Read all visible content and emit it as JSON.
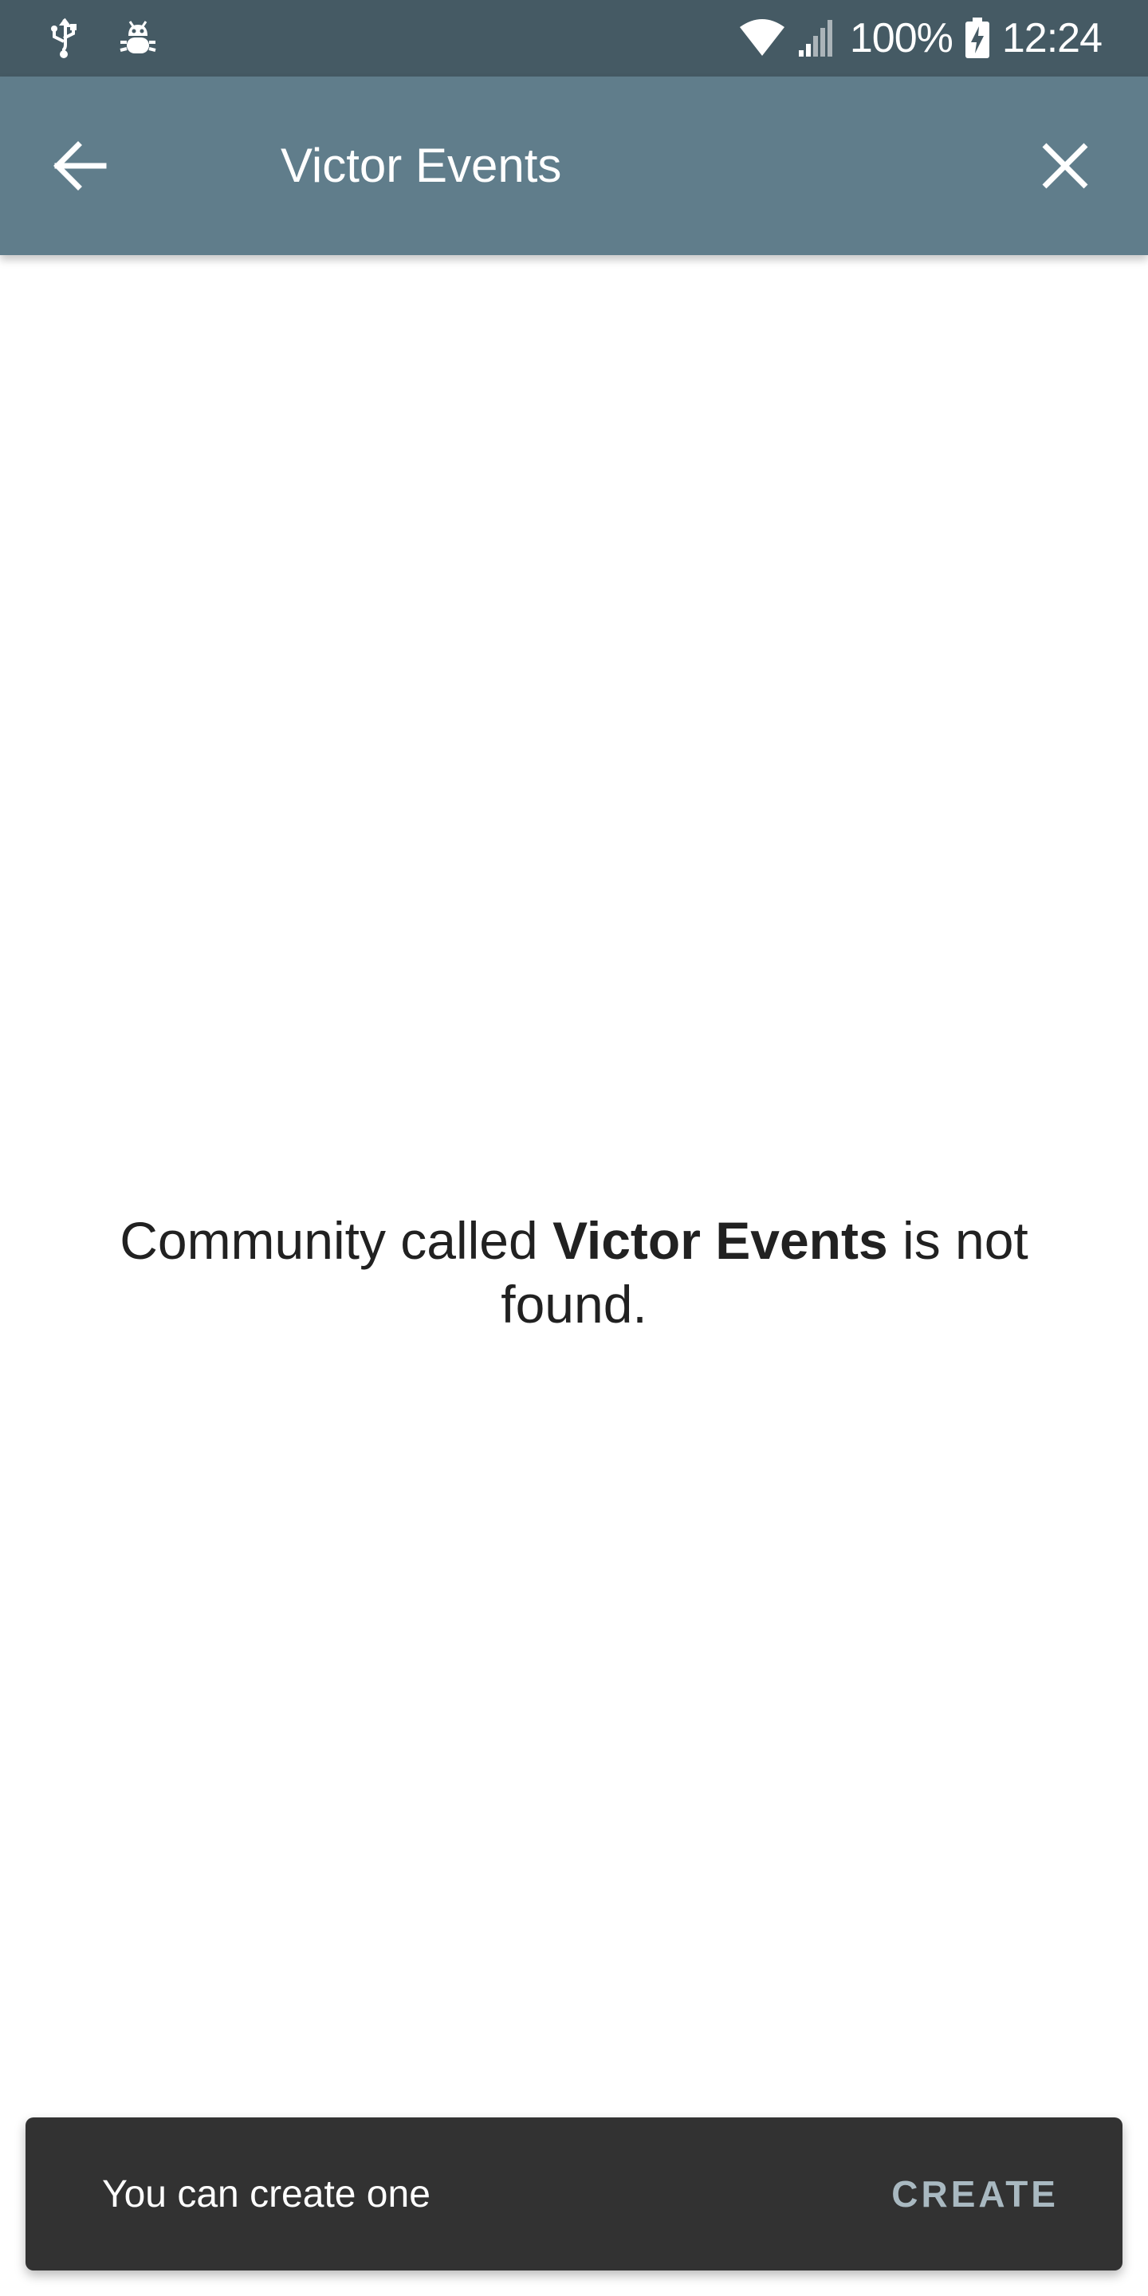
{
  "status_bar": {
    "left_icons": [
      "usb-icon",
      "debug-bug-icon"
    ],
    "right_icons": [
      "wifi-icon",
      "cell-signal-icon",
      "battery-charging-icon"
    ],
    "battery_text": "100%",
    "time": "12:24"
  },
  "app_bar": {
    "back_icon": "arrow-left-icon",
    "title": "Victor Events",
    "close_icon": "close-icon",
    "background_color": "#607d8b"
  },
  "main": {
    "message_prefix": "Community called ",
    "community_name": "Victor Events",
    "message_suffix_line1": " is not",
    "message_suffix_line2": "found."
  },
  "snackbar": {
    "text": "You can create one",
    "action_label": "CREATE",
    "background_color": "#323232",
    "action_color": "#a9b9c1"
  },
  "colors": {
    "status_bar": "#455a64",
    "background": "#ffffff",
    "text_primary": "#212121"
  }
}
